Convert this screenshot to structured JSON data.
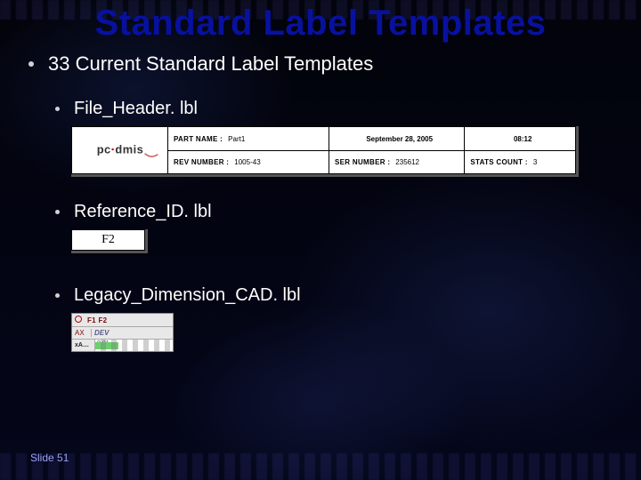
{
  "title": "Standard Label Templates",
  "bullets": {
    "top": "33 Current Standard Label Templates",
    "file_header": "File_Header. lbl",
    "reference_id": "Reference_ID. lbl",
    "legacy": "Legacy_Dimension_CAD. lbl"
  },
  "file_header_preview": {
    "logo_text": "pc·dmis",
    "cells": [
      {
        "label": "PART NAME :",
        "value": "Part1"
      },
      {
        "label": "",
        "value": "September 28, 2005",
        "center": true
      },
      {
        "label": "",
        "value": "08:12",
        "center": true
      },
      {
        "label": "REV NUMBER :",
        "value": "1005-43"
      },
      {
        "label": "SER NUMBER :",
        "value": "235612"
      },
      {
        "label": "STATS COUNT :",
        "value": "3"
      }
    ]
  },
  "reference_id_preview": {
    "value": "F2"
  },
  "legacy_preview": {
    "header": "F1 F2",
    "row2_left": "AX",
    "row2_right": "DEV",
    "bar_label": "xA…",
    "bar_value": "0.01"
  },
  "footer": "Slide 51"
}
